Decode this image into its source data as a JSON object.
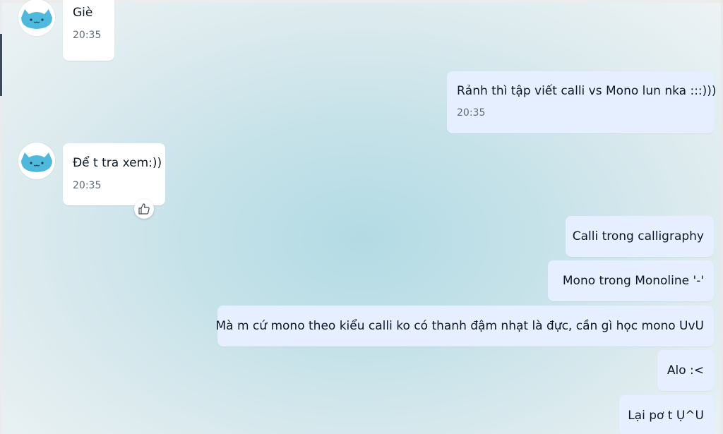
{
  "messages": [
    {
      "side": "in",
      "text": "Giè",
      "time": "20:35"
    },
    {
      "side": "out",
      "text": "Rảnh thì tập viết calli vs Mono lun nka :::)))",
      "time": "20:35"
    },
    {
      "side": "in",
      "text": "Để t tra xem:))",
      "time": "20:35",
      "reaction_icon": "thumbs-up-icon"
    },
    {
      "side": "out",
      "text": "Calli trong calligraphy"
    },
    {
      "side": "out",
      "text": "Mono trong Monoline '-'"
    },
    {
      "side": "out",
      "text": "Mà m cứ mono theo kiểu calli ko có thanh đậm nhạt là đực, cần gì học mono UvU"
    },
    {
      "side": "out",
      "text": "Alo :<"
    },
    {
      "side": "out",
      "text": "Lại pơ t Ụ^U"
    }
  ],
  "colors": {
    "incoming_bubble": "#ffffff",
    "outgoing_bubble": "#e5efff",
    "avatar_cat": "#4fb9dd",
    "text": "#0d1a26",
    "timestamp": "#5f6b77"
  }
}
